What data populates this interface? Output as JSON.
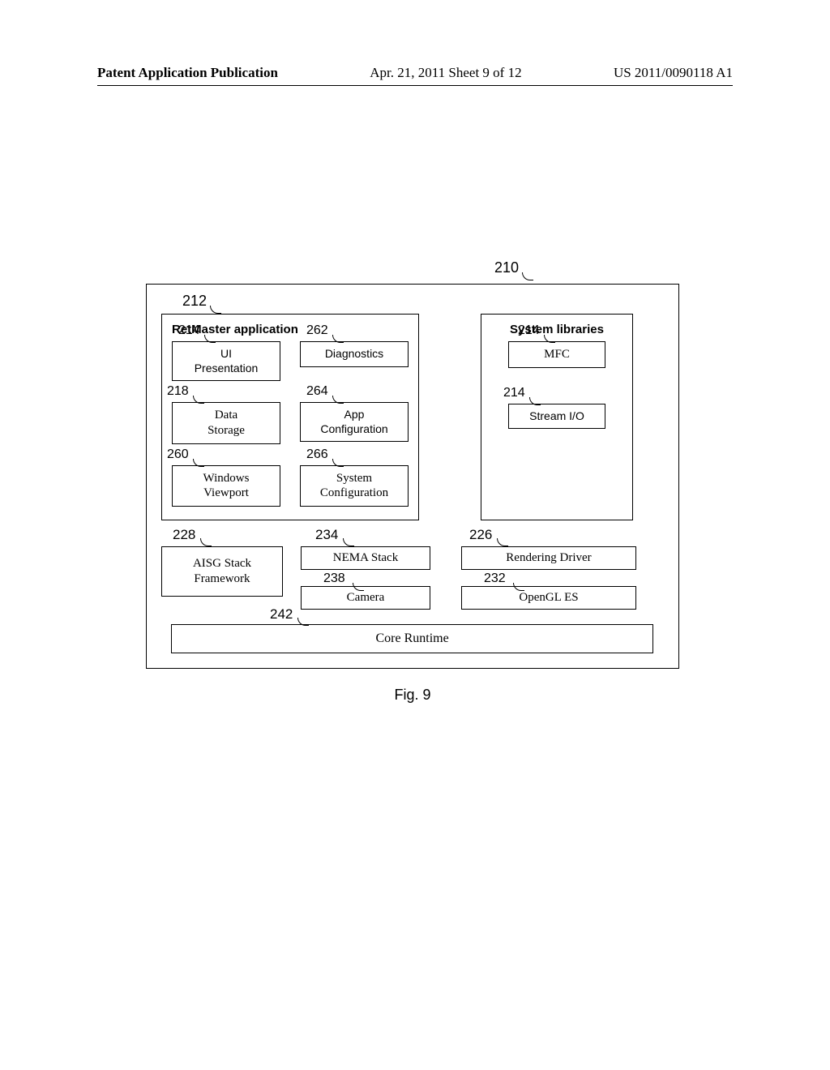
{
  "header": {
    "left": "Patent Application Publication",
    "center": "Apr. 21, 2011  Sheet 9 of 12",
    "right": "US 2011/0090118 A1"
  },
  "refs": {
    "outer": "210",
    "retmaster": "212",
    "ui_presentation": "214",
    "data_storage": "218",
    "windows_viewport": "260",
    "diagnostics": "262",
    "app_config": "264",
    "system_config": "266",
    "mfc": "214",
    "stream_io": "214",
    "aisg": "228",
    "nema": "234",
    "camera": "238",
    "rendering": "226",
    "opengl": "232",
    "runtime": "242"
  },
  "blocks": {
    "retmaster_title": "RetMaster application",
    "syslib_title": "System libraries",
    "ui_presentation": "UI\nPresentation",
    "diagnostics": "Diagnostics",
    "data_storage": "Data\nStorage",
    "app_config": "App\nConfiguration",
    "windows_viewport": "Windows\nViewport",
    "system_config": "System\nConfiguration",
    "mfc": "MFC",
    "stream_io": "Stream I/O",
    "aisg": "AISG Stack\nFramework",
    "nema": "NEMA Stack",
    "camera": "Camera",
    "rendering": "Rendering Driver",
    "opengl": "OpenGL ES",
    "runtime": "Core Runtime"
  },
  "caption": "Fig. 9"
}
